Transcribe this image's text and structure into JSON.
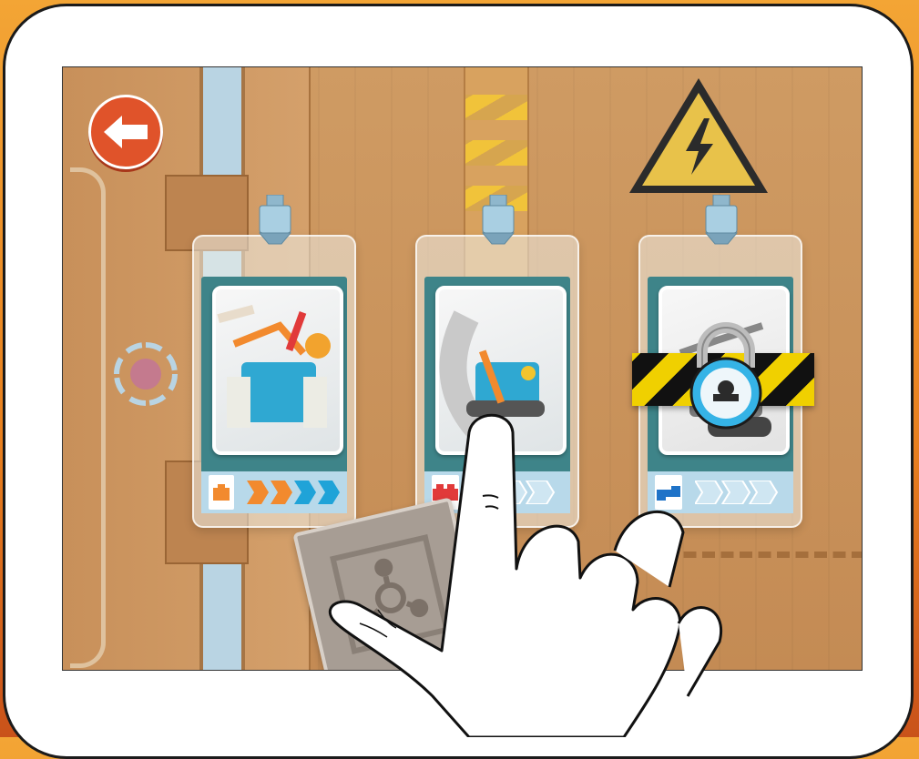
{
  "screen": {
    "back_button_icon": "arrow-left-icon",
    "cards": [
      {
        "name": "robot-card-1",
        "robot": "drill-robot",
        "brick_color": "#f28a2e",
        "energy_level": 1.0,
        "locked": false
      },
      {
        "name": "robot-card-2",
        "robot": "tracked-robot",
        "brick_color": "#e13a3a",
        "energy_level": 0.0,
        "locked": false
      },
      {
        "name": "robot-card-3",
        "robot": "excavator-robot",
        "brick_color": "#1f73c8",
        "energy_level": 0.0,
        "locked": true
      }
    ],
    "warning_sign_icon": "high-voltage-warning-icon",
    "tile_icon": "connection-hub-icon",
    "hand_icon": "pointing-hand-icon"
  },
  "colors": {
    "accent_back": "#e0532a",
    "teal_sheet": "#3e8489",
    "energy_full": "#f28a2e",
    "energy_blue": "#1fa3d8",
    "lock_blue": "#35b3e6",
    "stripe_yellow": "#f0d000"
  }
}
